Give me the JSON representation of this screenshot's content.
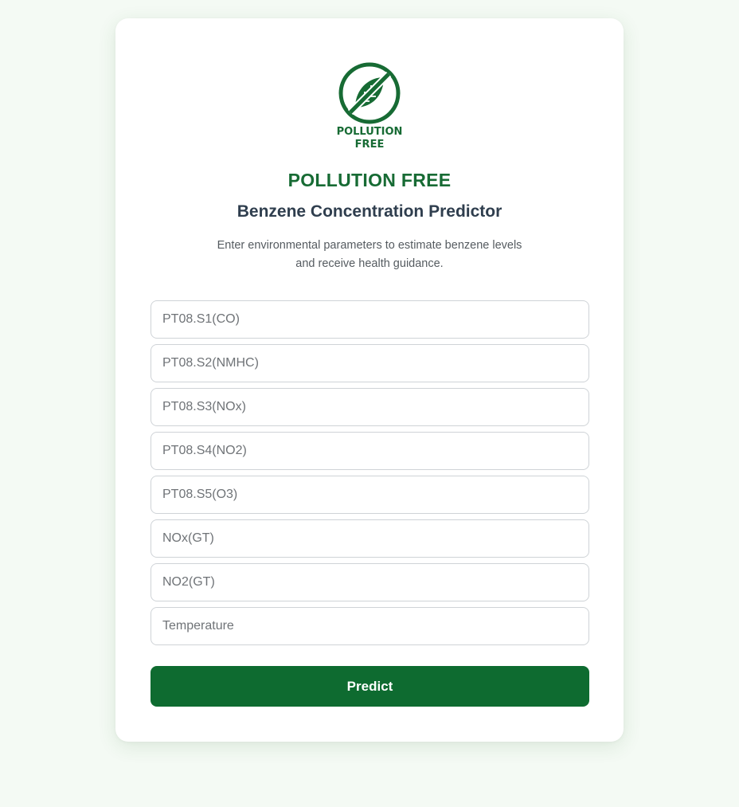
{
  "logo": {
    "text_line1": "POLLUTION",
    "text_line2": "FREE"
  },
  "brand": "POLLUTION FREE",
  "title": "Benzene Concentration Predictor",
  "subtitle_line1": "Enter environmental parameters to estimate benzene levels",
  "subtitle_line2": "and receive health guidance.",
  "form": {
    "fields": [
      {
        "placeholder": "PT08.S1(CO)",
        "value": ""
      },
      {
        "placeholder": "PT08.S2(NMHC)",
        "value": ""
      },
      {
        "placeholder": "PT08.S3(NOx)",
        "value": ""
      },
      {
        "placeholder": "PT08.S4(NO2)",
        "value": ""
      },
      {
        "placeholder": "PT08.S5(O3)",
        "value": ""
      },
      {
        "placeholder": "NOx(GT)",
        "value": ""
      },
      {
        "placeholder": "NO2(GT)",
        "value": ""
      },
      {
        "placeholder": "Temperature",
        "value": ""
      }
    ],
    "submit_label": "Predict"
  },
  "colors": {
    "brand_green": "#176b34",
    "button_green": "#0e6b30",
    "page_background": "#f4faf4"
  },
  "icons": {
    "logo": "no-leaf-icon"
  }
}
